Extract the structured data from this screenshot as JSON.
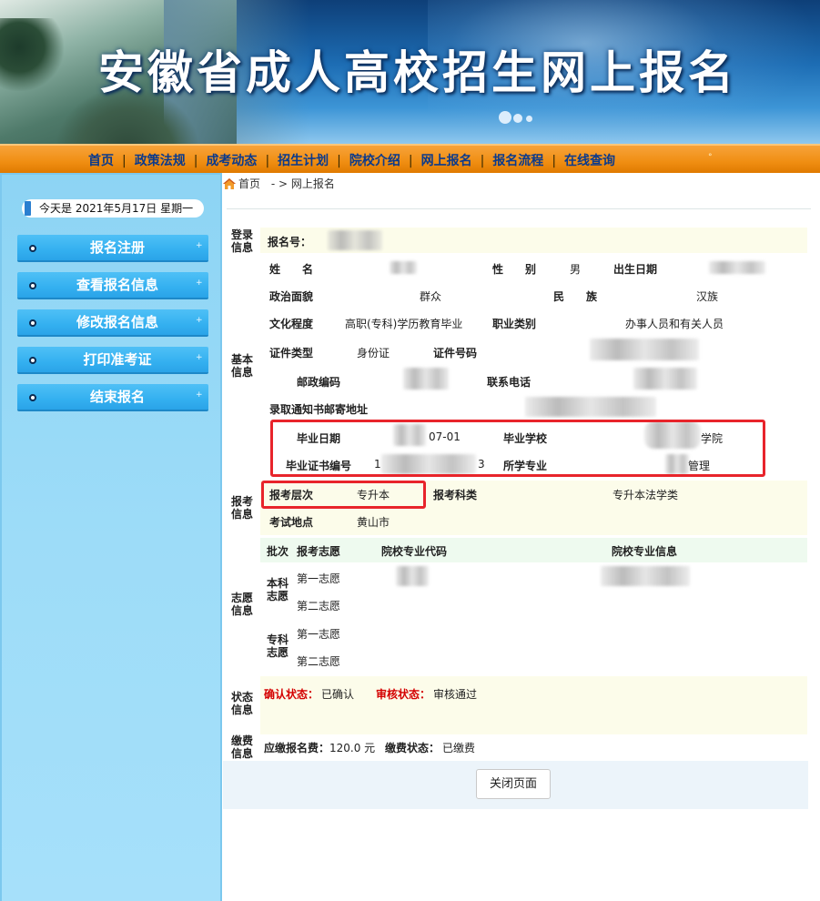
{
  "banner": {
    "title": "安徽省成人高校招生网上报名"
  },
  "nav": {
    "items": [
      "首页",
      "政策法规",
      "成考动态",
      "招生计划",
      "院校介绍",
      "网上报名",
      "报名流程",
      "在线查询"
    ],
    "separator": "|",
    "tail": "°"
  },
  "sidebar": {
    "date_text": "今天是  2021年5月17日  星期一",
    "menu": [
      {
        "label": "报名注册",
        "plus": "+"
      },
      {
        "label": "查看报名信息",
        "plus": "+"
      },
      {
        "label": "修改报名信息",
        "plus": "+"
      },
      {
        "label": "打印准考证",
        "plus": "+"
      },
      {
        "label": "结束报名",
        "plus": "+"
      }
    ]
  },
  "breadcrumb": {
    "home": "首页",
    "sep": "- >",
    "current": "网上报名"
  },
  "login": {
    "section": "登录信息",
    "reg_no_label": "报名号："
  },
  "basic": {
    "section": "基本信息",
    "name_label": "姓　　名",
    "gender_label": "性　　别",
    "gender_value": "男",
    "birth_label": "出生日期",
    "politics_label": "政治面貌",
    "politics_value": "群众",
    "ethnic_label": "民　　族",
    "ethnic_value": "汉族",
    "edu_label": "文化程度",
    "edu_value": "高职(专科)学历教育毕业",
    "job_label": "职业类别",
    "job_value": "办事人员和有关人员",
    "idtype_label": "证件类型",
    "idtype_value": "身份证",
    "idno_label": "证件号码",
    "postcode_label": "邮政编码",
    "phone_label": "联系电话",
    "address_label": "录取通知书邮寄地址",
    "grad_date_label": "毕业日期",
    "grad_date_value": "07-01",
    "grad_school_label": "毕业学校",
    "grad_school_value": "学院",
    "cert_no_label": "毕业证书编号",
    "cert_no_prefix": "1",
    "cert_no_suffix": "3",
    "major_label": "所学专业",
    "major_value": "管理"
  },
  "exam": {
    "section": "报考信息",
    "level_label": "报考层次",
    "level_value": "专升本",
    "subject_label": "报考科类",
    "subject_value": "专升本法学类",
    "site_label": "考试地点",
    "site_value": "黄山市"
  },
  "wish": {
    "section": "志愿信息",
    "headers": [
      "批次",
      "报考志愿",
      "院校专业代码",
      "院校专业信息"
    ],
    "batch_ben": "本科志愿",
    "batch_zhuan": "专科志愿",
    "first": "第一志愿",
    "second": "第二志愿"
  },
  "status": {
    "section": "状态信息",
    "confirm_label": "确认状态：",
    "confirm_value": "已确认",
    "audit_label": "审核状态：",
    "audit_value": "审核通过"
  },
  "fee": {
    "section": "缴费信息",
    "due_label": "应缴报名费：",
    "due_value": "120.0 元",
    "pay_label": "缴费状态：",
    "pay_value": "已缴费"
  },
  "close_button": "关闭页面",
  "colors": {
    "nav": "#f08e12",
    "sidebar": "#9ddcf8",
    "menu_button": "#34b0f0",
    "highlight_box": "#e8242b",
    "status_red": "#d40000"
  }
}
